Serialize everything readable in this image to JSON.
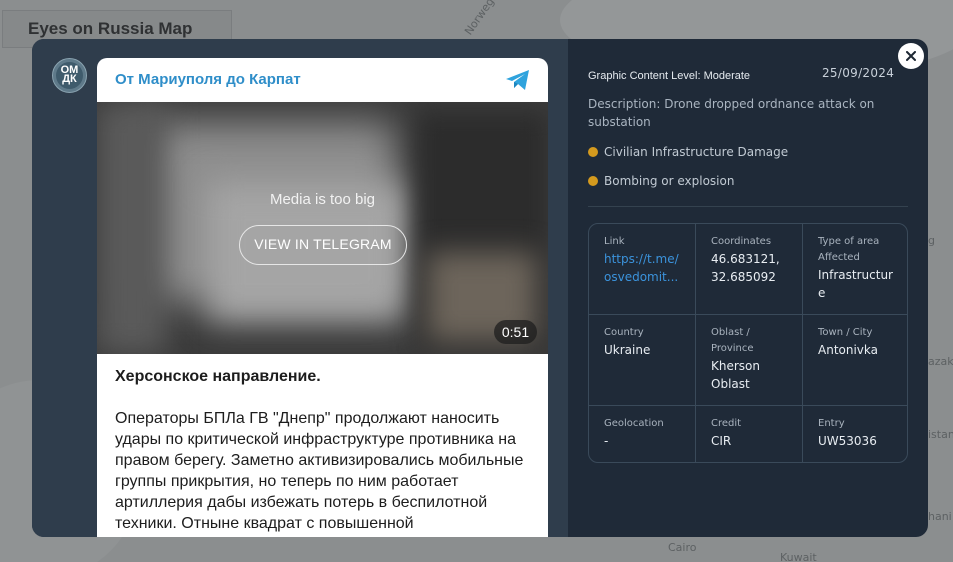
{
  "map": {
    "title": "Eyes on Russia Map",
    "labels": [
      "Norwegian",
      "Cairo",
      "Kuwait",
      "azak",
      "istan",
      "hani",
      "g"
    ]
  },
  "telegram": {
    "channel_name": "От Мариуполя до Карпат",
    "avatar_text": "ОМ ДК",
    "media_message": "Media is too big",
    "view_button": "VIEW IN TELEGRAM",
    "duration": "0:51",
    "post_heading": "Херсонское направление.",
    "post_body": "Операторы БПЛа ГВ \"Днепр\" продолжают наносить удары по критической инфраструктуре противника на правом берегу. Заметно активизировались мобильные группы прикрытия, но теперь по ним работает артиллерия дабы избежать потерь в беспилотной техники. Отныне квадрат с повышенной"
  },
  "details": {
    "severity": "Graphic Content Level: Moderate",
    "date": "25/09/2024",
    "description": "Description: Drone dropped ordnance attack on substation",
    "tags": [
      "Civilian Infrastructure Damage",
      "Bombing or explosion"
    ],
    "tag_color": "#d49a1e",
    "fields": {
      "link_label": "Link",
      "link_value": "https://t.me/osvedomit...",
      "coordinates_label": "Coordinates",
      "coordinates_value": "46.683121, 32.685092",
      "area_label": "Type of area Affected",
      "area_value": "Infrastructure",
      "country_label": "Country",
      "country_value": "Ukraine",
      "oblast_label": "Oblast / Province",
      "oblast_value": "Kherson Oblast",
      "town_label": "Town / City",
      "town_value": "Antonivka",
      "geolocation_label": "Geolocation",
      "geolocation_value": "-",
      "credit_label": "Credit",
      "credit_value": "CIR",
      "entry_label": "Entry",
      "entry_value": "UW53036"
    }
  },
  "icons": {
    "close": "close-icon",
    "telegram": "telegram-icon"
  }
}
